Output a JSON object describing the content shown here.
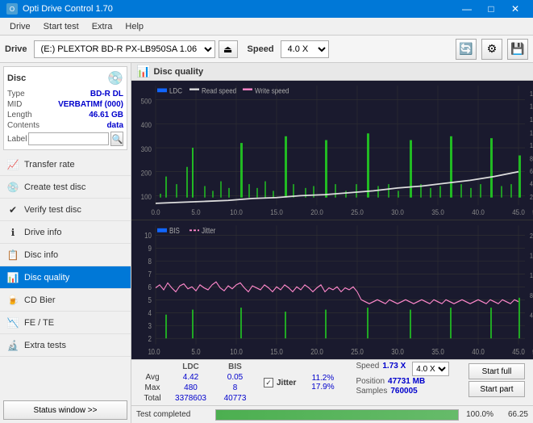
{
  "titlebar": {
    "title": "Opti Drive Control 1.70",
    "minimize": "—",
    "maximize": "□",
    "close": "✕"
  },
  "menubar": {
    "items": [
      "Drive",
      "Start test",
      "Extra",
      "Help"
    ]
  },
  "toolbar": {
    "drive_label": "Drive",
    "drive_value": "(E:)  PLEXTOR BD-R  PX-LB950SA 1.06",
    "speed_label": "Speed",
    "speed_value": "4.0 X"
  },
  "sidebar": {
    "disc_label": "Disc",
    "disc_type_key": "Type",
    "disc_type_val": "BD-R DL",
    "disc_mid_key": "MID",
    "disc_mid_val": "VERBATIMf (000)",
    "disc_length_key": "Length",
    "disc_length_val": "46.61 GB",
    "disc_contents_key": "Contents",
    "disc_contents_val": "data",
    "disc_label_key": "Label",
    "disc_label_val": "",
    "nav_items": [
      {
        "id": "transfer-rate",
        "label": "Transfer rate",
        "icon": "📈"
      },
      {
        "id": "create-test",
        "label": "Create test disc",
        "icon": "💿"
      },
      {
        "id": "verify-test",
        "label": "Verify test disc",
        "icon": "✔"
      },
      {
        "id": "drive-info",
        "label": "Drive info",
        "icon": "ℹ"
      },
      {
        "id": "disc-info",
        "label": "Disc info",
        "icon": "📋"
      },
      {
        "id": "disc-quality",
        "label": "Disc quality",
        "icon": "📊",
        "active": true
      },
      {
        "id": "cd-bier",
        "label": "CD Bier",
        "icon": "🍺"
      },
      {
        "id": "fe-te",
        "label": "FE / TE",
        "icon": "📉"
      },
      {
        "id": "extra-tests",
        "label": "Extra tests",
        "icon": "🔬"
      }
    ],
    "status_btn": "Status window >>"
  },
  "quality": {
    "title": "Disc quality",
    "legend": {
      "ldc": "LDC",
      "read_speed": "Read speed",
      "write_speed": "Write speed",
      "bis": "BIS",
      "jitter": "Jitter"
    }
  },
  "stats": {
    "headers": [
      "",
      "LDC",
      "BIS"
    ],
    "avg_label": "Avg",
    "avg_ldc": "4.42",
    "avg_bis": "0.05",
    "max_label": "Max",
    "max_ldc": "480",
    "max_bis": "8",
    "total_label": "Total",
    "total_ldc": "3378603",
    "total_bis": "40773",
    "jitter_checked": true,
    "jitter_label": "Jitter",
    "jitter_avg": "11.2%",
    "jitter_max": "17.9%",
    "jitter_total": "",
    "speed_label": "Speed",
    "speed_val": "1.73 X",
    "speed_select": "4.0 X",
    "position_label": "Position",
    "position_val": "47731 MB",
    "samples_label": "Samples",
    "samples_val": "760005",
    "btn_start_full": "Start full",
    "btn_start_part": "Start part"
  },
  "progress": {
    "status_text": "Test completed",
    "percent": "100.0%",
    "speed": "66.25"
  }
}
